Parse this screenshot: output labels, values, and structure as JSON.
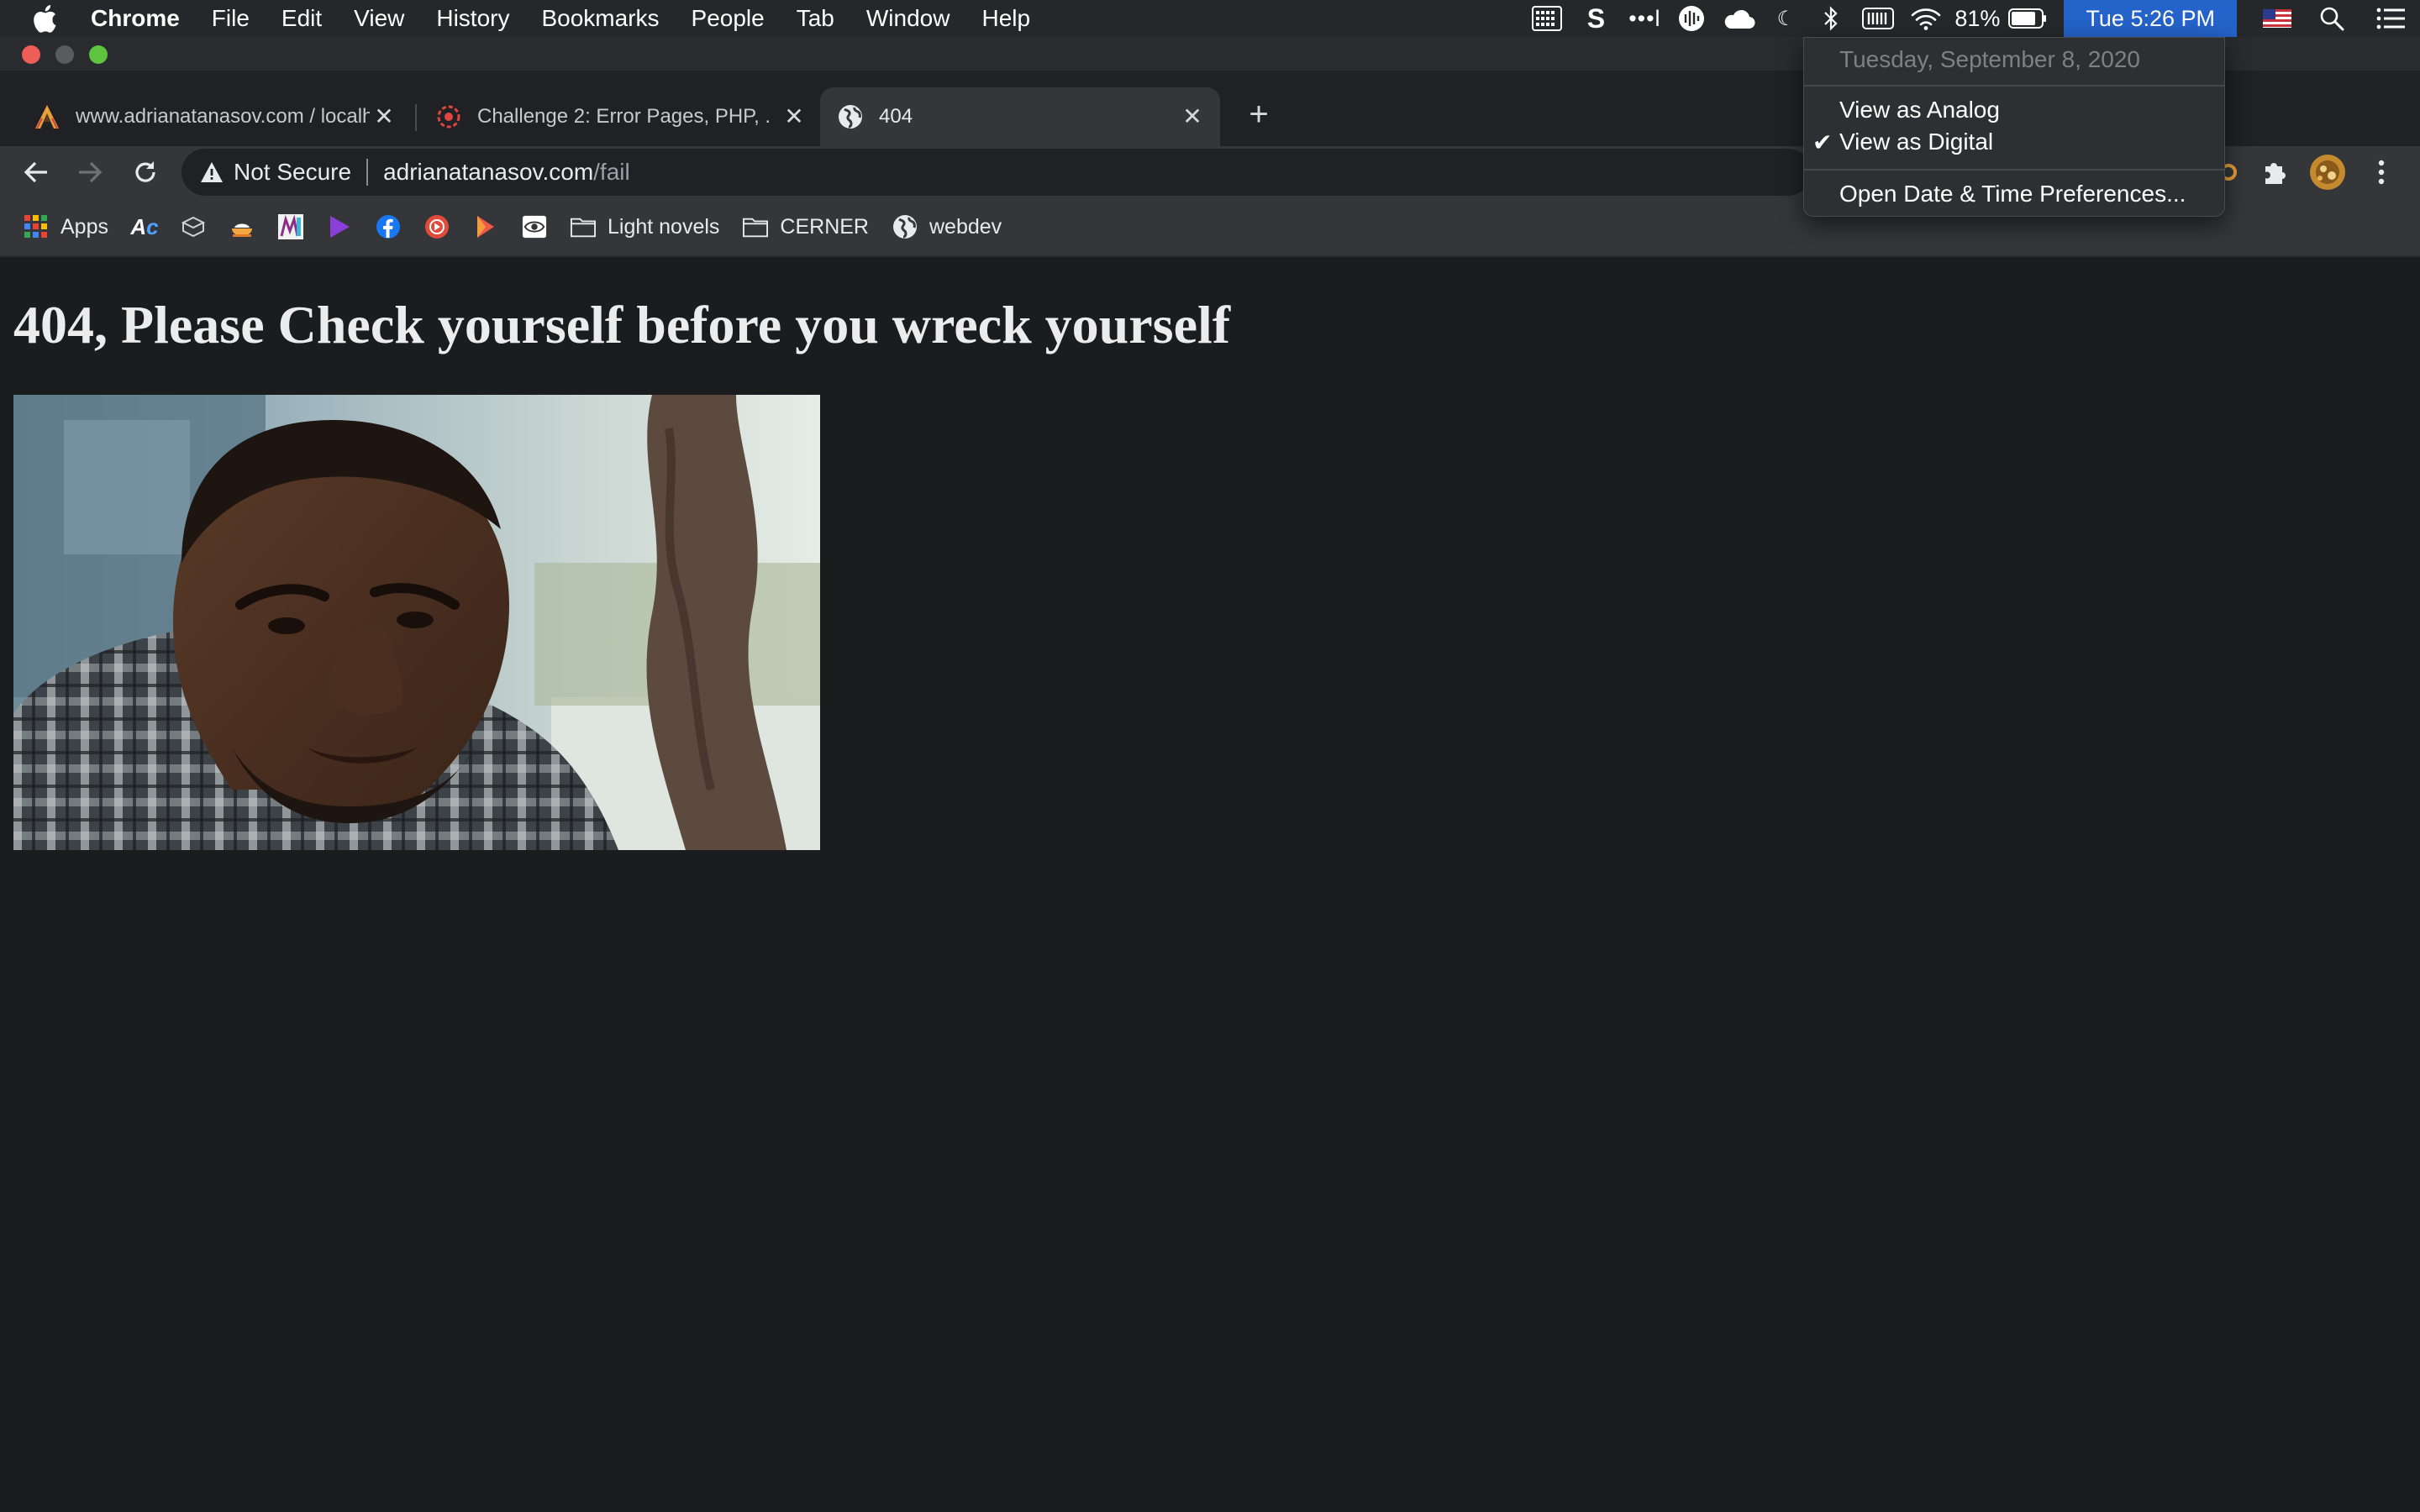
{
  "menubar": {
    "app_name": "Chrome",
    "items": [
      "File",
      "Edit",
      "View",
      "History",
      "Bookmarks",
      "People",
      "Tab",
      "Window",
      "Help"
    ],
    "status": {
      "battery_percent": "81%",
      "clock": "Tue 5:26 PM"
    }
  },
  "tabs": [
    {
      "title": "www.adrianatanasov.com / localhost",
      "active": false
    },
    {
      "title": "Challenge 2: Error Pages, PHP, ...",
      "active": false
    },
    {
      "title": "404",
      "active": true
    }
  ],
  "omnibox": {
    "security_label": "Not Secure",
    "host": "adrianatanasov.com",
    "path": "/fail"
  },
  "bookmarks": {
    "apps_label": "Apps",
    "folders": [
      "Light novels",
      "CERNER"
    ],
    "webdev_label": "webdev"
  },
  "page": {
    "heading": "404, Please Check yourself before you wreck yourself"
  },
  "clock_menu": {
    "date": "Tuesday, September 8, 2020",
    "analog_label": "View as Analog",
    "digital_label": "View as Digital",
    "digital_checked": true,
    "prefs_label": "Open Date & Time Preferences..."
  },
  "colors": {
    "accent_blue": "#2463c9",
    "page_bg": "#1b1c1e",
    "toolbar_bg": "#35363a"
  }
}
